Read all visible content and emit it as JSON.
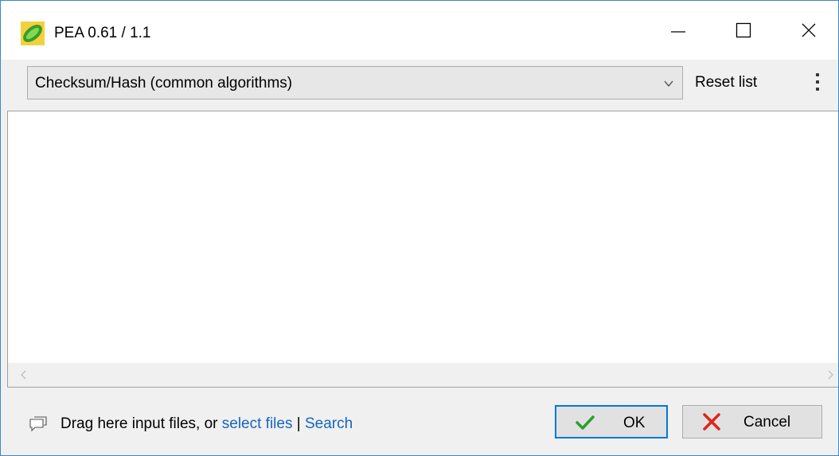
{
  "window": {
    "title": "PEA 0.61 / 1.1",
    "app_icon": "pea-pod-icon",
    "controls": {
      "minimize_icon": "minimize-icon",
      "maximize_icon": "maximize-icon",
      "close_icon": "close-icon"
    }
  },
  "toolbar": {
    "function_select": {
      "value": "Checksum/Hash (common algorithms)",
      "icon": "chevron-down-icon"
    },
    "reset_label": "Reset list",
    "more_icon": "vertical-ellipsis-icon"
  },
  "file_list": {
    "scroll_left_icon": "chevron-left-icon",
    "scroll_right_icon": "chevron-right-icon"
  },
  "footer": {
    "hint_icon": "speech-bubble-icon",
    "hint_prefix": "Drag here input files, or ",
    "select_files_label": "select files",
    "separator": " | ",
    "search_label": "Search",
    "ok_label": "OK",
    "ok_icon": "checkmark-icon",
    "cancel_label": "Cancel",
    "cancel_icon": "cross-icon"
  },
  "colors": {
    "window_border": "#3c86c8",
    "link": "#1565c0",
    "ok_check": "#2e9e2e",
    "cancel_cross": "#e0241b",
    "default_button_border": "#0078d7"
  }
}
